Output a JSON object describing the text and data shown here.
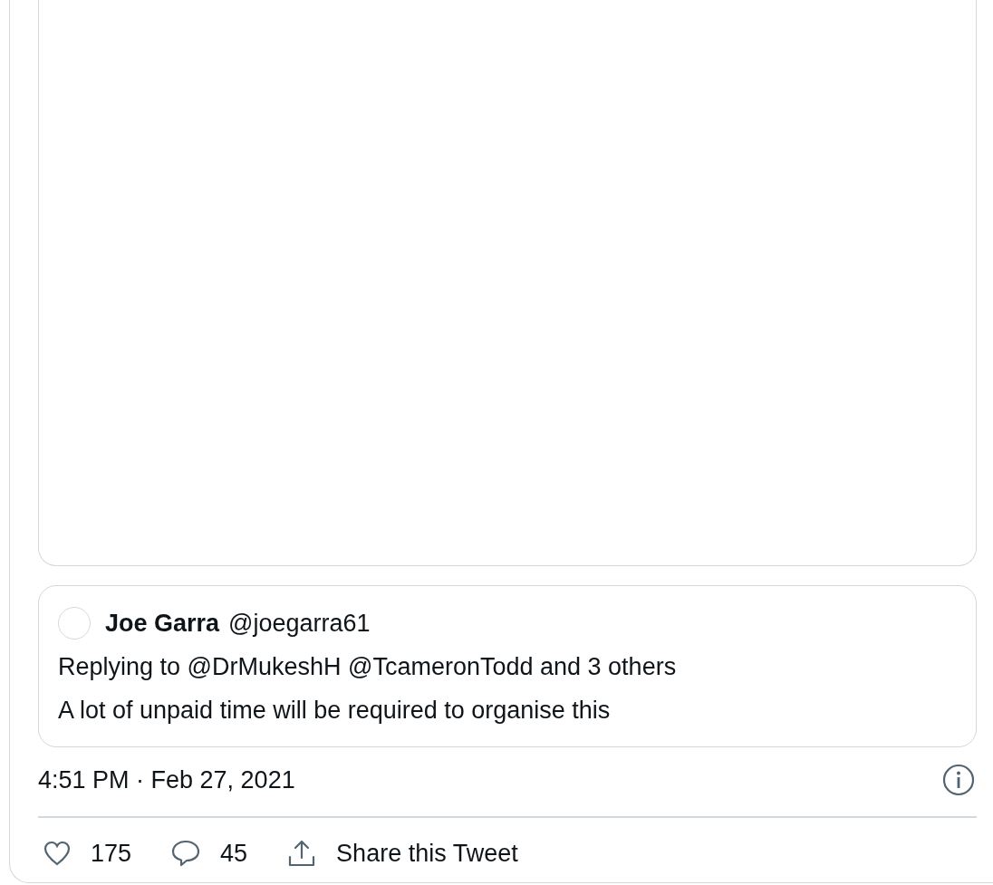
{
  "quoted_tweet": {
    "name": "Joe Garra",
    "handle": "@joegarra61",
    "replying_to": "Replying to @DrMukeshH @TcameronTodd and 3 others",
    "text": "A lot of unpaid time will be required to organise this"
  },
  "timestamp": "4:51 PM · Feb 27, 2021",
  "actions": [
    {
      "kind": "like",
      "count": "175"
    },
    {
      "kind": "reply",
      "count": "45"
    },
    {
      "kind": "share",
      "label": "Share this Tweet"
    }
  ]
}
